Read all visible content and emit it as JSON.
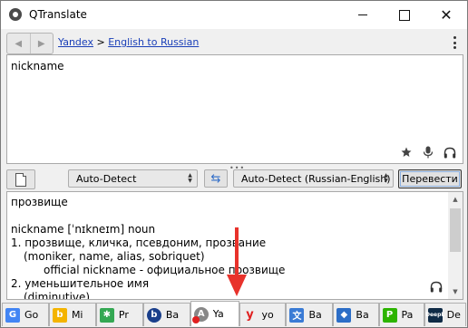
{
  "window": {
    "title": "QTranslate"
  },
  "nav": {
    "service": "Yandex",
    "separator": ">",
    "direction": "English to Russian"
  },
  "source": {
    "text": "nickname"
  },
  "toolbar": {
    "from_language": "Auto-Detect",
    "to_language": "Auto-Detect (Russian-English)",
    "translate_label": "Перевести"
  },
  "result": {
    "lines": [
      "прозвище",
      "",
      "nickname [ˈnɪkneɪm] noun",
      "1. прозвище, кличка, псевдоним, прозвание",
      "(moniker, name, alias, sobriquet)",
      "official nickname - официальное прозвище",
      "2. уменьшительное имя",
      "(diminutive)"
    ]
  },
  "tabs": [
    {
      "label": "Go",
      "icon": "google-icon",
      "color": "#4285f4"
    },
    {
      "label": "Mi",
      "icon": "bing-icon",
      "color": "#f4b400"
    },
    {
      "label": "Pr",
      "icon": "promt-icon",
      "color": "#34a853"
    },
    {
      "label": "Ba",
      "icon": "babylon-icon",
      "color": "#1a3f8b"
    },
    {
      "label": "Ya",
      "icon": "yandex-icon",
      "color": "#888888",
      "active": true
    },
    {
      "label": "yo",
      "icon": "youdao-icon",
      "color": "#e02020"
    },
    {
      "label": "Ba",
      "icon": "baidu-icon",
      "color": "#3a7bd5"
    },
    {
      "label": "Ba",
      "icon": "baidu-map-icon",
      "color": "#2c6ec7"
    },
    {
      "label": "Pa",
      "icon": "papago-icon",
      "color": "#2db400"
    },
    {
      "label": "De",
      "icon": "deepl-icon",
      "color": "#0f2b46"
    }
  ],
  "colors": {
    "link": "#1a3fb8",
    "annotation_arrow": "#e8322b"
  }
}
